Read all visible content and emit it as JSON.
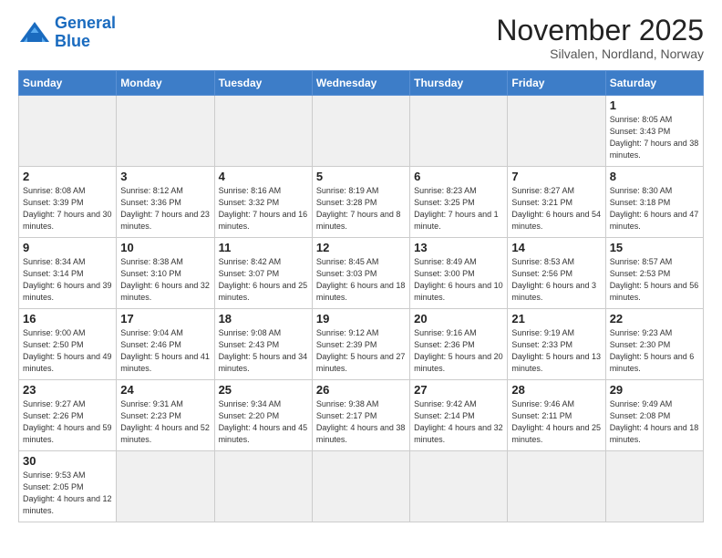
{
  "logo": {
    "line1": "General",
    "line2": "Blue"
  },
  "title": "November 2025",
  "subtitle": "Silvalen, Nordland, Norway",
  "days_of_week": [
    "Sunday",
    "Monday",
    "Tuesday",
    "Wednesday",
    "Thursday",
    "Friday",
    "Saturday"
  ],
  "weeks": [
    [
      {
        "day": "",
        "info": ""
      },
      {
        "day": "",
        "info": ""
      },
      {
        "day": "",
        "info": ""
      },
      {
        "day": "",
        "info": ""
      },
      {
        "day": "",
        "info": ""
      },
      {
        "day": "",
        "info": ""
      },
      {
        "day": "1",
        "info": "Sunrise: 8:05 AM\nSunset: 3:43 PM\nDaylight: 7 hours\nand 38 minutes."
      }
    ],
    [
      {
        "day": "2",
        "info": "Sunrise: 8:08 AM\nSunset: 3:39 PM\nDaylight: 7 hours\nand 30 minutes."
      },
      {
        "day": "3",
        "info": "Sunrise: 8:12 AM\nSunset: 3:36 PM\nDaylight: 7 hours\nand 23 minutes."
      },
      {
        "day": "4",
        "info": "Sunrise: 8:16 AM\nSunset: 3:32 PM\nDaylight: 7 hours\nand 16 minutes."
      },
      {
        "day": "5",
        "info": "Sunrise: 8:19 AM\nSunset: 3:28 PM\nDaylight: 7 hours\nand 8 minutes."
      },
      {
        "day": "6",
        "info": "Sunrise: 8:23 AM\nSunset: 3:25 PM\nDaylight: 7 hours\nand 1 minute."
      },
      {
        "day": "7",
        "info": "Sunrise: 8:27 AM\nSunset: 3:21 PM\nDaylight: 6 hours\nand 54 minutes."
      },
      {
        "day": "8",
        "info": "Sunrise: 8:30 AM\nSunset: 3:18 PM\nDaylight: 6 hours\nand 47 minutes."
      }
    ],
    [
      {
        "day": "9",
        "info": "Sunrise: 8:34 AM\nSunset: 3:14 PM\nDaylight: 6 hours\nand 39 minutes."
      },
      {
        "day": "10",
        "info": "Sunrise: 8:38 AM\nSunset: 3:10 PM\nDaylight: 6 hours\nand 32 minutes."
      },
      {
        "day": "11",
        "info": "Sunrise: 8:42 AM\nSunset: 3:07 PM\nDaylight: 6 hours\nand 25 minutes."
      },
      {
        "day": "12",
        "info": "Sunrise: 8:45 AM\nSunset: 3:03 PM\nDaylight: 6 hours\nand 18 minutes."
      },
      {
        "day": "13",
        "info": "Sunrise: 8:49 AM\nSunset: 3:00 PM\nDaylight: 6 hours\nand 10 minutes."
      },
      {
        "day": "14",
        "info": "Sunrise: 8:53 AM\nSunset: 2:56 PM\nDaylight: 6 hours\nand 3 minutes."
      },
      {
        "day": "15",
        "info": "Sunrise: 8:57 AM\nSunset: 2:53 PM\nDaylight: 5 hours\nand 56 minutes."
      }
    ],
    [
      {
        "day": "16",
        "info": "Sunrise: 9:00 AM\nSunset: 2:50 PM\nDaylight: 5 hours\nand 49 minutes."
      },
      {
        "day": "17",
        "info": "Sunrise: 9:04 AM\nSunset: 2:46 PM\nDaylight: 5 hours\nand 41 minutes."
      },
      {
        "day": "18",
        "info": "Sunrise: 9:08 AM\nSunset: 2:43 PM\nDaylight: 5 hours\nand 34 minutes."
      },
      {
        "day": "19",
        "info": "Sunrise: 9:12 AM\nSunset: 2:39 PM\nDaylight: 5 hours\nand 27 minutes."
      },
      {
        "day": "20",
        "info": "Sunrise: 9:16 AM\nSunset: 2:36 PM\nDaylight: 5 hours\nand 20 minutes."
      },
      {
        "day": "21",
        "info": "Sunrise: 9:19 AM\nSunset: 2:33 PM\nDaylight: 5 hours\nand 13 minutes."
      },
      {
        "day": "22",
        "info": "Sunrise: 9:23 AM\nSunset: 2:30 PM\nDaylight: 5 hours\nand 6 minutes."
      }
    ],
    [
      {
        "day": "23",
        "info": "Sunrise: 9:27 AM\nSunset: 2:26 PM\nDaylight: 4 hours\nand 59 minutes."
      },
      {
        "day": "24",
        "info": "Sunrise: 9:31 AM\nSunset: 2:23 PM\nDaylight: 4 hours\nand 52 minutes."
      },
      {
        "day": "25",
        "info": "Sunrise: 9:34 AM\nSunset: 2:20 PM\nDaylight: 4 hours\nand 45 minutes."
      },
      {
        "day": "26",
        "info": "Sunrise: 9:38 AM\nSunset: 2:17 PM\nDaylight: 4 hours\nand 38 minutes."
      },
      {
        "day": "27",
        "info": "Sunrise: 9:42 AM\nSunset: 2:14 PM\nDaylight: 4 hours\nand 32 minutes."
      },
      {
        "day": "28",
        "info": "Sunrise: 9:46 AM\nSunset: 2:11 PM\nDaylight: 4 hours\nand 25 minutes."
      },
      {
        "day": "29",
        "info": "Sunrise: 9:49 AM\nSunset: 2:08 PM\nDaylight: 4 hours\nand 18 minutes."
      }
    ],
    [
      {
        "day": "30",
        "info": "Sunrise: 9:53 AM\nSunset: 2:05 PM\nDaylight: 4 hours\nand 12 minutes."
      },
      {
        "day": "",
        "info": ""
      },
      {
        "day": "",
        "info": ""
      },
      {
        "day": "",
        "info": ""
      },
      {
        "day": "",
        "info": ""
      },
      {
        "day": "",
        "info": ""
      },
      {
        "day": "",
        "info": ""
      }
    ]
  ]
}
